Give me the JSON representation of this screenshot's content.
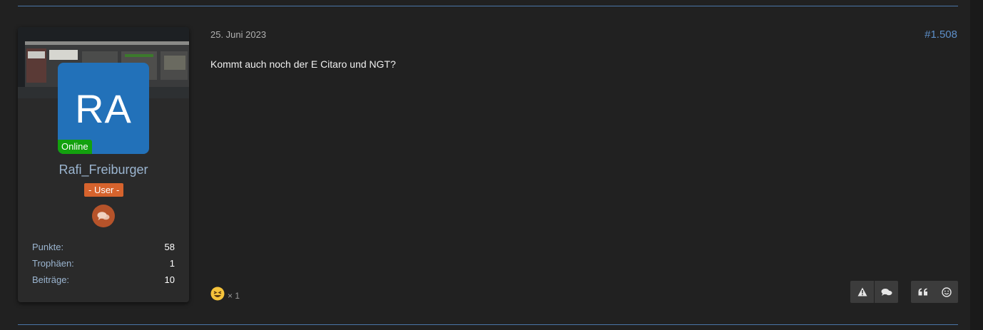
{
  "user": {
    "avatar_initials": "RA",
    "online_label": "Online",
    "username": "Rafi_Freiburger",
    "rank": "- User -",
    "badge_icon": "chat-bubbles-icon",
    "stats": [
      {
        "label": "Punkte:",
        "value": "58"
      },
      {
        "label": "Trophäen:",
        "value": "1"
      },
      {
        "label": "Beiträge:",
        "value": "10"
      }
    ]
  },
  "post": {
    "date": "25. Juni 2023",
    "number": "#1.508",
    "text": "Kommt auch noch der E Citaro und NGT?",
    "reaction": {
      "emoji": "😆",
      "count": "× 1"
    }
  },
  "actions": {
    "report_icon": "warning-icon",
    "reply_icon": "comments-icon",
    "quote_icon": "quote-icon",
    "react_icon": "smiley-icon"
  },
  "colors": {
    "background": "#212121",
    "accent": "#4a76a8",
    "avatar": "#2271b9",
    "online": "#13a10e",
    "rank": "#d6632d",
    "link": "#5d8fc9"
  }
}
